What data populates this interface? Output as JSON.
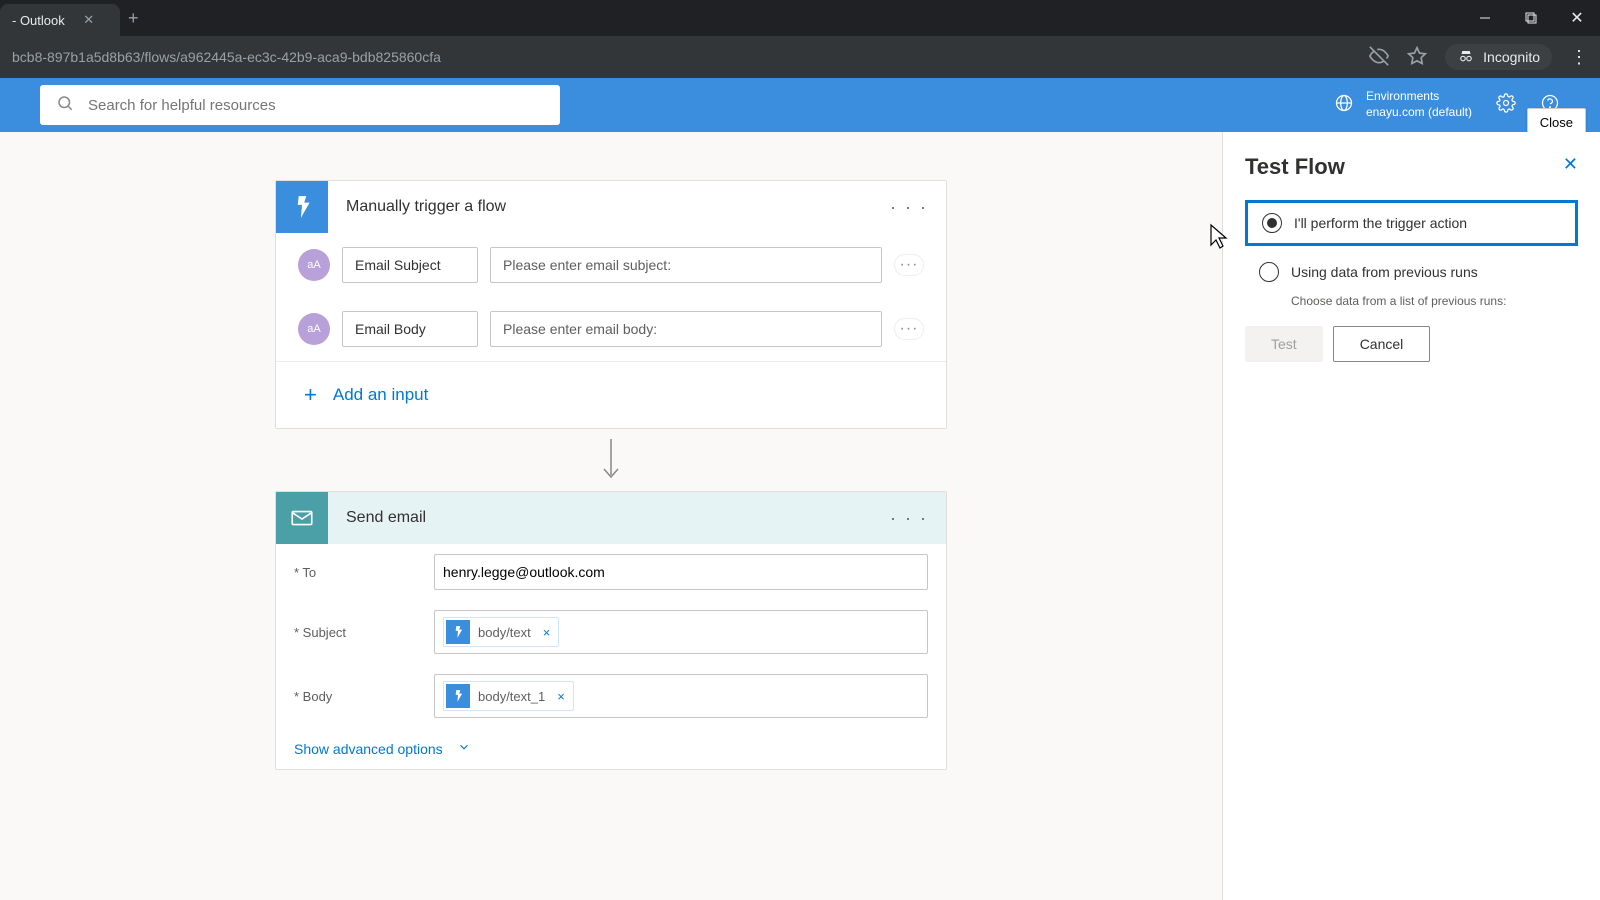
{
  "browser": {
    "tab_title": "- Outlook",
    "url": "bcb8-897b1a5d8b63/flows/a962445a-ec3c-42b9-aca9-bdb825860cfa",
    "incognito_label": "Incognito"
  },
  "header": {
    "search_placeholder": "Search for helpful resources",
    "env_label": "Environments",
    "env_value": "enayu.com (default)",
    "close_tooltip": "Close"
  },
  "trigger_card": {
    "title": "Manually trigger a flow",
    "inputs": [
      {
        "avatar": "aA",
        "name": "Email Subject",
        "placeholder": "Please enter email subject:"
      },
      {
        "avatar": "aA",
        "name": "Email Body",
        "placeholder": "Please enter email body:"
      }
    ],
    "add_input_label": "Add an input"
  },
  "action_card": {
    "title": "Send email",
    "fields": {
      "to_label": "* To",
      "to_value": "henry.legge@outlook.com",
      "subject_label": "* Subject",
      "subject_token": "body/text",
      "body_label": "* Body",
      "body_token": "body/text_1"
    },
    "adv_label": "Show advanced options"
  },
  "panel": {
    "title": "Test Flow",
    "option1": "I'll perform the trigger action",
    "option2": "Using data from previous runs",
    "option2_sub": "Choose data from a list of previous runs:",
    "test_btn": "Test",
    "cancel_btn": "Cancel"
  }
}
